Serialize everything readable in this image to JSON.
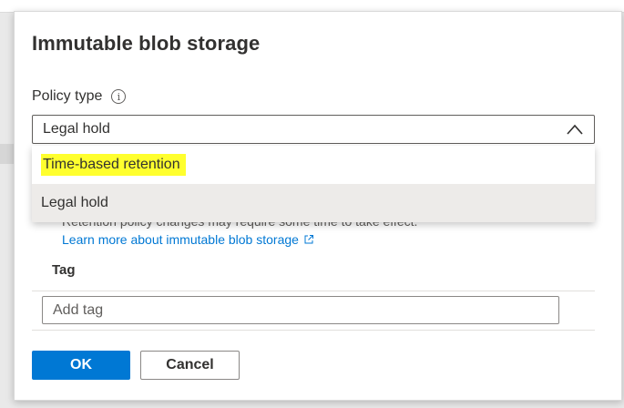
{
  "dialog": {
    "title": "Immutable blob storage",
    "policy_type": {
      "label": "Policy type",
      "info_icon": "info-icon",
      "selected_value": "Legal hold",
      "dropdown_icon": "chevron-up-icon",
      "options": [
        {
          "label": "Time-based retention",
          "highlighted": true,
          "highlight_color": "#ffff2e"
        },
        {
          "label": "Legal hold",
          "selected": true
        }
      ]
    },
    "notice_text": "Retention policy changes may require some time to take effect.",
    "learn_more": {
      "label": "Learn more about immutable blob storage",
      "icon": "external-link-icon"
    },
    "tag": {
      "header": "Tag",
      "input_value": "",
      "input_placeholder": "Add tag"
    },
    "buttons": {
      "ok_label": "OK",
      "cancel_label": "Cancel"
    }
  },
  "colors": {
    "accent": "#0078d4",
    "text": "#323130",
    "selected_row": "#edebe9"
  }
}
